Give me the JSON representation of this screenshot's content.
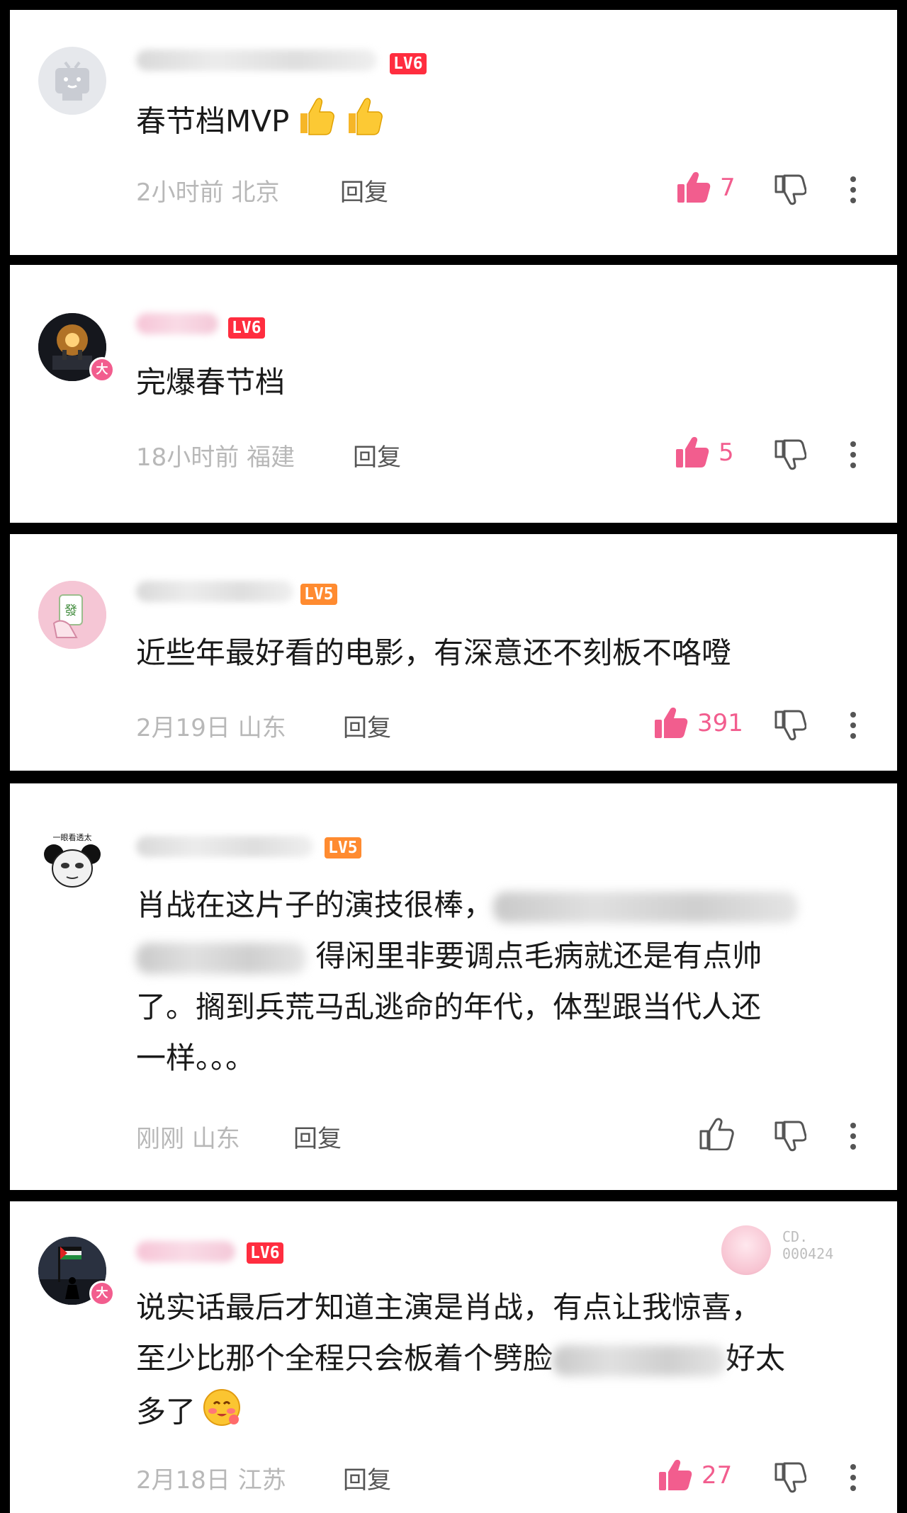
{
  "comments": [
    {
      "level": "LV6",
      "text": "春节档MVP",
      "emoji": [
        "thumbs-up-emoji",
        "thumbs-up-emoji"
      ],
      "time": "2小时前",
      "location": "北京",
      "reply_label": "回复",
      "like_count": "7",
      "liked": true
    },
    {
      "level": "LV6",
      "text": "完爆春节档",
      "badge": "大",
      "time": "18小时前",
      "location": "福建",
      "reply_label": "回复",
      "like_count": "5",
      "liked": true
    },
    {
      "level": "LV5",
      "text": "近些年最好看的电影，有深意还不刻板不咯噔",
      "time": "2月19日",
      "location": "山东",
      "reply_label": "回复",
      "like_count": "391",
      "liked": true
    },
    {
      "level": "LV5",
      "avatar_text": "一眼看透太",
      "lines": [
        "肖战在这片子的演技很棒，",
        "得闲里非要调点毛病就还是有点帅",
        "了。搁到兵荒马乱逃命的年代，体型跟当代人还",
        "一样。。。"
      ],
      "time": "刚刚",
      "location": "山东",
      "reply_label": "回复",
      "like_count": "",
      "liked": false
    },
    {
      "level": "LV6",
      "badge": "大",
      "stamp": "CD.\n000424",
      "lines": [
        "说实话最后才知道主演是肖战，有点让我惊喜，",
        "至少比那个全程只会板着个劈脸",
        "好太",
        "多了"
      ],
      "time": "2月18日",
      "location": "江苏",
      "reply_label": "回复",
      "like_count": "27",
      "liked": true
    }
  ],
  "colors": {
    "accent_pink": "#f25d8e",
    "lv6": "#ff2d3f",
    "lv5": "#ff8b30",
    "meta_gray": "#b8b8b8"
  }
}
